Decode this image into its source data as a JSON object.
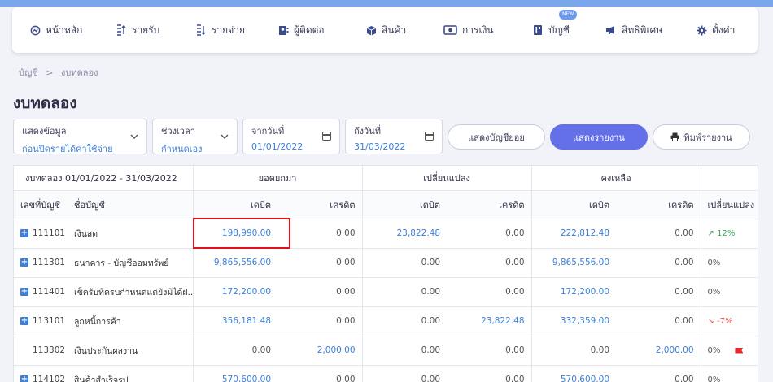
{
  "nav": {
    "items": [
      {
        "label": "หน้าหลัก",
        "icon": "dashboard-icon"
      },
      {
        "label": "รายรับ",
        "icon": "income-icon"
      },
      {
        "label": "รายจ่าย",
        "icon": "expense-icon"
      },
      {
        "label": "ผู้ติดต่อ",
        "icon": "contacts-icon"
      },
      {
        "label": "สินค้า",
        "icon": "box-icon"
      },
      {
        "label": "การเงิน",
        "icon": "money-icon"
      },
      {
        "label": "บัญชี",
        "icon": "book-icon",
        "badge": "NEW"
      },
      {
        "label": "สิทธิพิเศษ",
        "icon": "megaphone-icon"
      },
      {
        "label": "ตั้งค่า",
        "icon": "gear-icon"
      }
    ]
  },
  "breadcrumb": {
    "parent": "บัญชี",
    "separator": ">",
    "current": "งบทดลอง"
  },
  "page_title": "งบทดลอง",
  "filters": {
    "display": {
      "label": "แสดงข้อมูล",
      "value": "ก่อนปิดรายได้ค่าใช้จ่าย"
    },
    "period": {
      "label": "ช่วงเวลา",
      "value": "กำหนดเอง"
    },
    "from_date": {
      "label": "จากวันที่",
      "value": "01/01/2022"
    },
    "to_date": {
      "label": "ถึงวันที่",
      "value": "31/03/2022"
    }
  },
  "buttons": {
    "sub_accounts": "แสดงบัญชีย่อย",
    "show_report": "แสดงรายงาน",
    "print_report": "พิมพ์รายงาน"
  },
  "colors": {
    "primary": "#6470e8",
    "link": "#3d7fd9",
    "up": "#3aa55f",
    "down": "#e05545",
    "highlight": "#e0121b"
  },
  "table": {
    "group_headers": {
      "period": "งบทดลอง 01/01/2022 - 31/03/2022",
      "brought_forward": "ยอดยกมา",
      "change": "เปลี่ยนแปลง",
      "remaining": "คงเหลือ"
    },
    "columns": {
      "code": "เลขที่บัญชี",
      "name": "ชื่อบัญชี",
      "debit": "เดบิต",
      "credit": "เครดิต",
      "pct_change": "เปลี่ยนแปลง"
    },
    "rows": [
      {
        "expandable": true,
        "code": "111101",
        "name": "เงินสด",
        "bf_debit": "198,990.00",
        "bf_credit": "0.00",
        "ch_debit": "23,822.48",
        "ch_credit": "0.00",
        "rm_debit": "222,812.48",
        "rm_credit": "0.00",
        "pct": "12%",
        "trend": "up"
      },
      {
        "expandable": true,
        "code": "111301",
        "name": "ธนาคาร - บัญชีออมทรัพย์",
        "bf_debit": "9,865,556.00",
        "bf_credit": "0.00",
        "ch_debit": "0.00",
        "ch_credit": "0.00",
        "rm_debit": "9,865,556.00",
        "rm_credit": "0.00",
        "pct": "0%",
        "trend": "none"
      },
      {
        "expandable": true,
        "code": "111401",
        "name": "เช็ครับที่ครบกำหนดแต่ยังมิได้ฝ...",
        "bf_debit": "172,200.00",
        "bf_credit": "0.00",
        "ch_debit": "0.00",
        "ch_credit": "0.00",
        "rm_debit": "172,200.00",
        "rm_credit": "0.00",
        "pct": "0%",
        "trend": "none"
      },
      {
        "expandable": true,
        "code": "113101",
        "name": "ลูกหนี้การค้า",
        "bf_debit": "356,181.48",
        "bf_credit": "0.00",
        "ch_debit": "0.00",
        "ch_credit": "23,822.48",
        "rm_debit": "332,359.00",
        "rm_credit": "0.00",
        "pct": "-7%",
        "trend": "down"
      },
      {
        "expandable": false,
        "code": "113302",
        "name": "เงินประกันผลงาน",
        "bf_debit": "0.00",
        "bf_credit": "2,000.00",
        "ch_debit": "0.00",
        "ch_credit": "0.00",
        "rm_debit": "0.00",
        "rm_credit": "2,000.00",
        "pct": "0%",
        "trend": "flag"
      },
      {
        "expandable": true,
        "code": "114102",
        "name": "สินค้าสำเร็จรูป",
        "bf_debit": "570,600.00",
        "bf_credit": "0.00",
        "ch_debit": "0.00",
        "ch_credit": "0.00",
        "rm_debit": "570,600.00",
        "rm_credit": "0.00",
        "pct": "0%",
        "trend": "none"
      }
    ]
  }
}
